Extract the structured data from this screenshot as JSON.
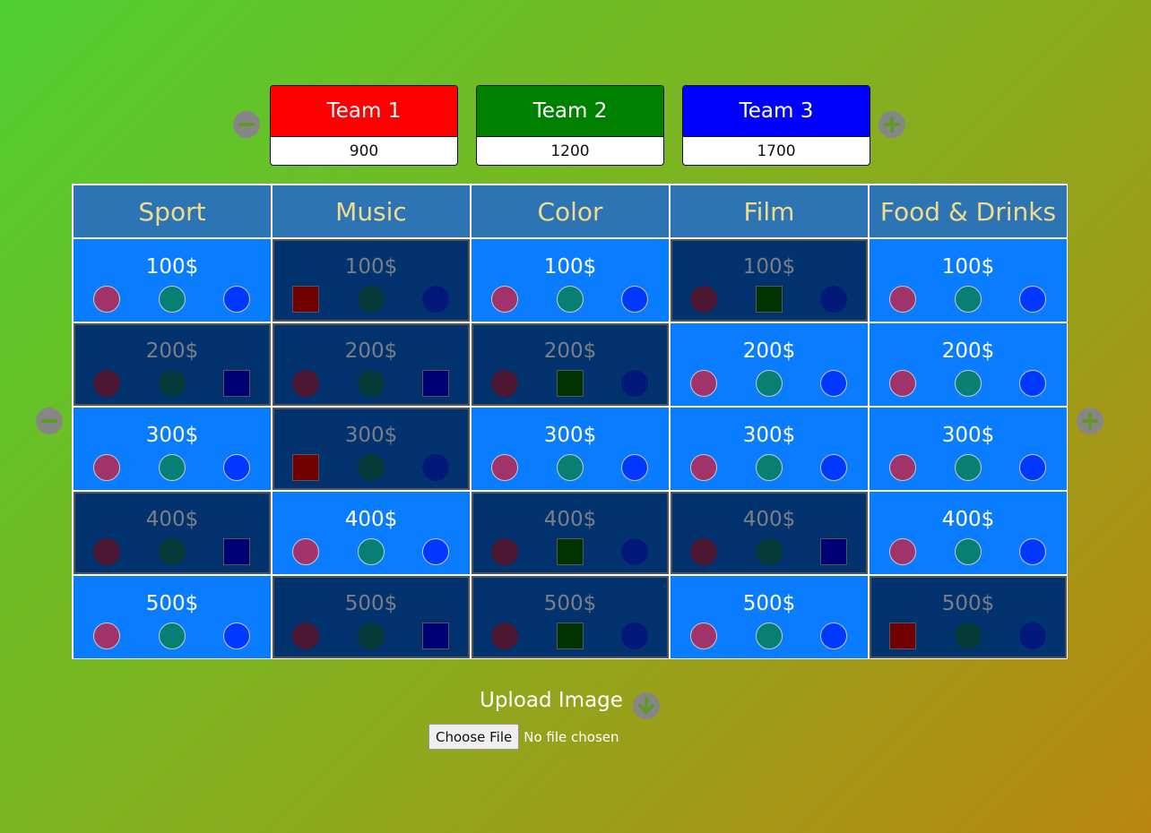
{
  "teams": [
    {
      "name": "Team 1",
      "score": "900",
      "color": "#ff0000"
    },
    {
      "name": "Team 2",
      "score": "1200",
      "color": "#008000"
    },
    {
      "name": "Team 3",
      "score": "1700",
      "color": "#0000ff"
    }
  ],
  "categories": [
    "Sport",
    "Music",
    "Color",
    "Film",
    "Food & Drinks"
  ],
  "values": [
    "100$",
    "200$",
    "300$",
    "400$",
    "500$"
  ],
  "board_state": {
    "description_note": "",
    "cells": [
      [
        "active",
        "used:1",
        "active",
        "used:2",
        "active"
      ],
      [
        "used:3",
        "used:3",
        "used:2",
        "active",
        "active"
      ],
      [
        "active",
        "used:1",
        "active",
        "active",
        "active"
      ],
      [
        "used:3",
        "active",
        "used:2",
        "used:3",
        "active"
      ],
      [
        "active",
        "used:3",
        "used:2",
        "active",
        "used:1"
      ]
    ]
  },
  "upload": {
    "title": "Upload Image",
    "button": "Choose File",
    "status": "No file chosen"
  },
  "colors": {
    "category_header": "#2c74b4",
    "category_text": "#f2dc8a",
    "cell_active": "#0a7cff",
    "cell_used": "#03336f",
    "team1_marker": "#a0336a",
    "team2_marker": "#078073",
    "team3_marker": "#0038ff"
  },
  "icons": {
    "remove_team": "minus-circle-icon",
    "add_team": "plus-circle-icon",
    "remove_row": "minus-circle-icon",
    "add_row": "plus-circle-icon",
    "upload": "arrow-down-circle-icon"
  }
}
